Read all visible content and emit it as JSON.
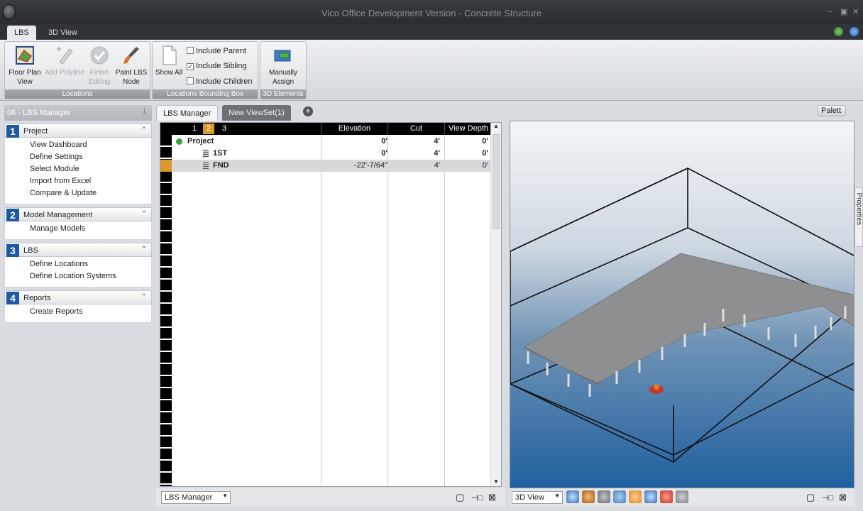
{
  "window": {
    "title": "Vico Office Development Version - Concrete Structure",
    "min": "–",
    "max": "▣",
    "close": "✕"
  },
  "ribbon": {
    "tabs": [
      "LBS",
      "3D View"
    ],
    "groups": {
      "locations": {
        "label": "Locations",
        "buttons": [
          "Floor Plan View",
          "Add Polyline",
          "Finish Editing",
          "Paint LBS Node"
        ]
      },
      "bounding": {
        "label": "Locations Bounding Box",
        "show_all": "Show All",
        "checks": [
          {
            "label": "Include Parent",
            "checked": false
          },
          {
            "label": "Include Sibling",
            "checked": true
          },
          {
            "label": "Include Children",
            "checked": false
          }
        ]
      },
      "elements": {
        "label": "3D Elements",
        "button": "Manually Assign"
      }
    }
  },
  "left_panel": {
    "title": "06 - LBS Manager",
    "sections": [
      {
        "num": "1",
        "title": "Project",
        "items": [
          "View Dashboard",
          "Define Settings",
          "Select Module",
          "Import from Excel",
          "Compare & Update"
        ]
      },
      {
        "num": "2",
        "title": "Model Management",
        "items": [
          "Manage Models"
        ]
      },
      {
        "num": "3",
        "title": "LBS",
        "items": [
          "Define Locations",
          "Define Location Systems"
        ]
      },
      {
        "num": "4",
        "title": "Reports",
        "items": [
          "Create Reports"
        ]
      }
    ]
  },
  "doc_tabs": [
    "LBS Manager",
    "New ViewSet(1)"
  ],
  "palette_label": "Palett",
  "properties_label": "Properties",
  "grid": {
    "level_numbers": [
      "1",
      "2",
      "3"
    ],
    "active_level": "2",
    "columns": [
      "Elevation",
      "Cut",
      "View Depth"
    ],
    "rows": [
      {
        "name": "Project",
        "elevation": "0'",
        "cut": "4'",
        "depth": "0'",
        "level": 0,
        "selected": false
      },
      {
        "name": "1ST",
        "elevation": "0'",
        "cut": "4'",
        "depth": "0'",
        "level": 1,
        "selected": false
      },
      {
        "name": "FND",
        "elevation": "-22'-7/64\"",
        "cut": "4'",
        "depth": "0'",
        "level": 1,
        "selected": true
      }
    ]
  },
  "bottom": {
    "grid_view": "LBS Manager",
    "view3d": "3D View"
  },
  "colors": {
    "accent_blue": "#1f5a9e",
    "active_level": "#d99a2b",
    "ribbon_label": "#8e9398"
  }
}
